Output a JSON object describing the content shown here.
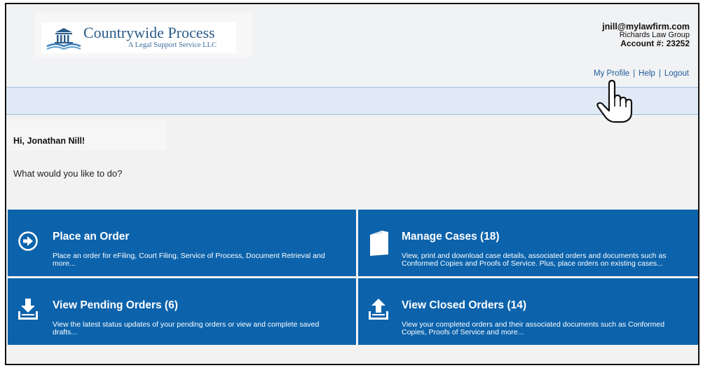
{
  "brand": {
    "name": "Countrywide Process",
    "tagline": "A Legal Support Service LLC"
  },
  "account": {
    "email": "jnill@mylawfirm.com",
    "firm": "Richards Law Group",
    "account_number": "Account #: 23252"
  },
  "nav": {
    "my_profile": "My Profile",
    "help": "Help",
    "logout": "Logout",
    "separator": "|"
  },
  "greeting": "Hi, Jonathan Nill!",
  "prompt": "What would you like to do?",
  "tiles": [
    {
      "title": "Place an Order",
      "description": "Place an order for eFiling, Court Filing, Service of Process, Document Retrieval and more...",
      "icon": "arrow-circle-icon"
    },
    {
      "title": "Manage Cases (18)",
      "description": "View, print and download case details, associated orders and documents such as Conformed Copies and Proofs of Service. Plus, place orders on existing cases...",
      "icon": "folder-icon"
    },
    {
      "title": "View Pending Orders (6)",
      "description": "View the latest status updates of your pending orders or view and complete saved drafts...",
      "icon": "download-tray-icon"
    },
    {
      "title": "View Closed Orders (14)",
      "description": "View your completed orders and their associated documents such as Conformed Copies, Proofs of Service and more...",
      "icon": "upload-tray-icon"
    }
  ],
  "colors": {
    "tile_blue": "#0c63ac",
    "link_blue": "#1f5c9a",
    "header_bar": "#dfeaf6"
  }
}
